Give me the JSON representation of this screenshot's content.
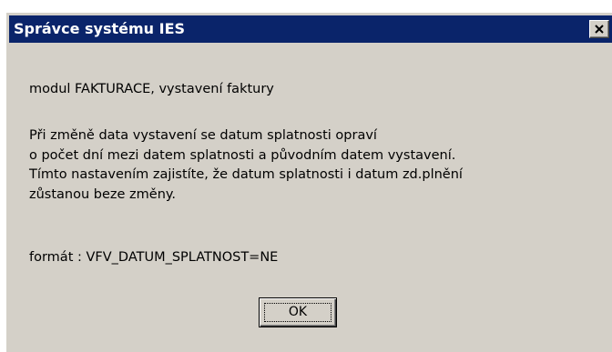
{
  "dialog": {
    "title": "Správce systému IES",
    "module_line": "modul FAKTURACE, vystavení faktury",
    "description": [
      "Při změně data vystavení se datum splatnosti opraví",
      "o počet dní mezi datem splatnosti a původním datem vystavení.",
      "Tímto nastavením zajistíte, že datum splatnosti i datum zd.plnění",
      "zůstanou beze změny."
    ],
    "format_line": "formát : VFV_DATUM_SPLATNOST=NE",
    "ok_label": "OK",
    "close_icon": "close-x-icon",
    "colors": {
      "titlebar": "#0a246a",
      "window_bg": "#d4d0c8",
      "title_text": "#ffffff"
    }
  }
}
